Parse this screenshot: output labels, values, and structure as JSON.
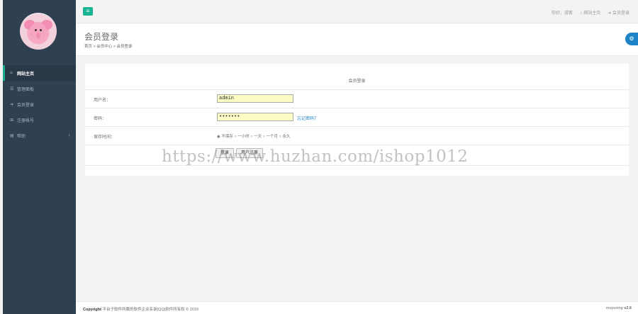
{
  "sidebar": {
    "items": [
      {
        "icon": "home-icon",
        "glyph": "⌂",
        "label": "网站主页"
      },
      {
        "icon": "list-icon",
        "glyph": "☰",
        "label": "管理面板"
      },
      {
        "icon": "sign-in-icon",
        "glyph": "➜",
        "label": "会员登录"
      },
      {
        "icon": "register-icon",
        "glyph": "⊞",
        "label": "注册帐号"
      },
      {
        "icon": "file-icon",
        "glyph": "▤",
        "label": "帮助",
        "chevron": "‹"
      }
    ]
  },
  "topbar": {
    "menu_glyph": "≡",
    "greeting": "你好，游客",
    "home_link": "网站主页",
    "login_link": "会员登录"
  },
  "heading": {
    "title": "会员登录",
    "breadcrumb": "首页 > 会员中心 > 会员登录"
  },
  "panel": {
    "title": "会员登录",
    "username_label": "用户名：",
    "username_value": "admin",
    "password_label": "密码：",
    "password_value": "•••••••",
    "forgot": "忘记密码？",
    "remember_label": "保存时间：",
    "remember_options": "◉ 不保存 ○ 一小时 ○ 一天 ○ 一个月 ○ 永久",
    "login_button": "登录",
    "register_button": "用户注册"
  },
  "watermark": "https://www.huzhan.com/ishop1012",
  "footer": {
    "copyright_bold": "Copyright",
    "copyright": " 平台于软件所属的软件企业名录[QQ]软件所有权 © 2019",
    "version_name": "moyuning",
    "version": "v2.6"
  },
  "colors": {
    "sidebar": "#2f4050",
    "accent": "#1ab394",
    "link": "#1c84c6"
  }
}
